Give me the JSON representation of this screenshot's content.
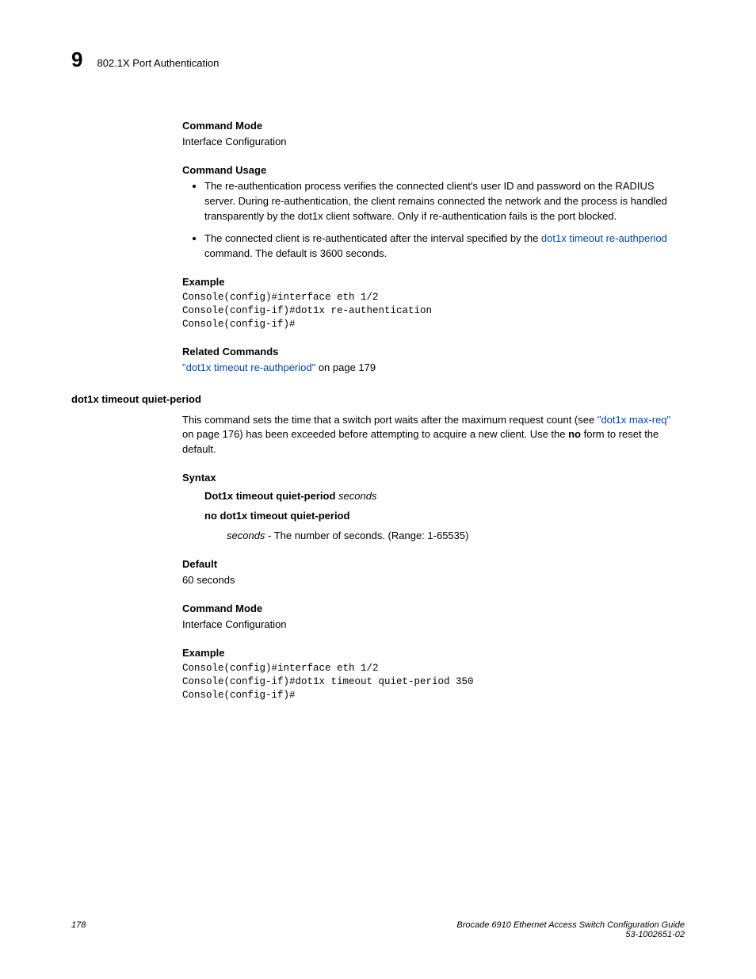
{
  "header": {
    "chapter_number": "9",
    "chapter_title": "802.1X Port Authentication"
  },
  "section1": {
    "command_mode_h": "Command Mode",
    "command_mode_v": "Interface Configuration",
    "command_usage_h": "Command Usage",
    "bullets": [
      {
        "text_before": "The re-authentication process verifies the connected client's user ID and password on the RADIUS server. During re-authentication, the client remains connected the network and the process is handled transparently by the dot1x client software. Only if re-authentication fails is the port blocked.",
        "link": "",
        "text_after": ""
      },
      {
        "text_before": "The connected client is re-authenticated after the interval specified by the ",
        "link": "dot1x timeout re-authperiod",
        "text_after": " command. The default is 3600 seconds."
      }
    ],
    "example_h": "Example",
    "example_code": "Console(config)#interface eth 1/2\nConsole(config-if)#dot1x re-authentication\nConsole(config-if)#",
    "related_h": "Related Commands",
    "related_link": "\"dot1x timeout re-authperiod\"",
    "related_after": " on page 179"
  },
  "section2": {
    "name": "dot1x timeout quiet-period",
    "desc_before": "This command sets the time that a switch port waits after the maximum request count (see ",
    "desc_link": "\"dot1x max-req\"",
    "desc_mid": " on page 176) has been exceeded before attempting to acquire a new client. Use the ",
    "desc_bold": "no",
    "desc_after": " form to reset the default.",
    "syntax_h": "Syntax",
    "syntax_line1_bold": "Dot1x timeout quiet-period",
    "syntax_line1_ital": " seconds",
    "syntax_line2_bold": "no dot1x timeout quiet-period",
    "syntax_desc_ital": "seconds",
    "syntax_desc_rest": " - The number of seconds. (Range: 1-65535)",
    "default_h": "Default",
    "default_v": "60 seconds",
    "command_mode_h": "Command Mode",
    "command_mode_v": "Interface Configuration",
    "example_h": "Example",
    "example_code": "Console(config)#interface eth 1/2\nConsole(config-if)#dot1x timeout quiet-period 350\nConsole(config-if)#"
  },
  "footer": {
    "page": "178",
    "title": "Brocade 6910 Ethernet Access Switch Configuration Guide",
    "docnum": "53-1002651-02"
  }
}
